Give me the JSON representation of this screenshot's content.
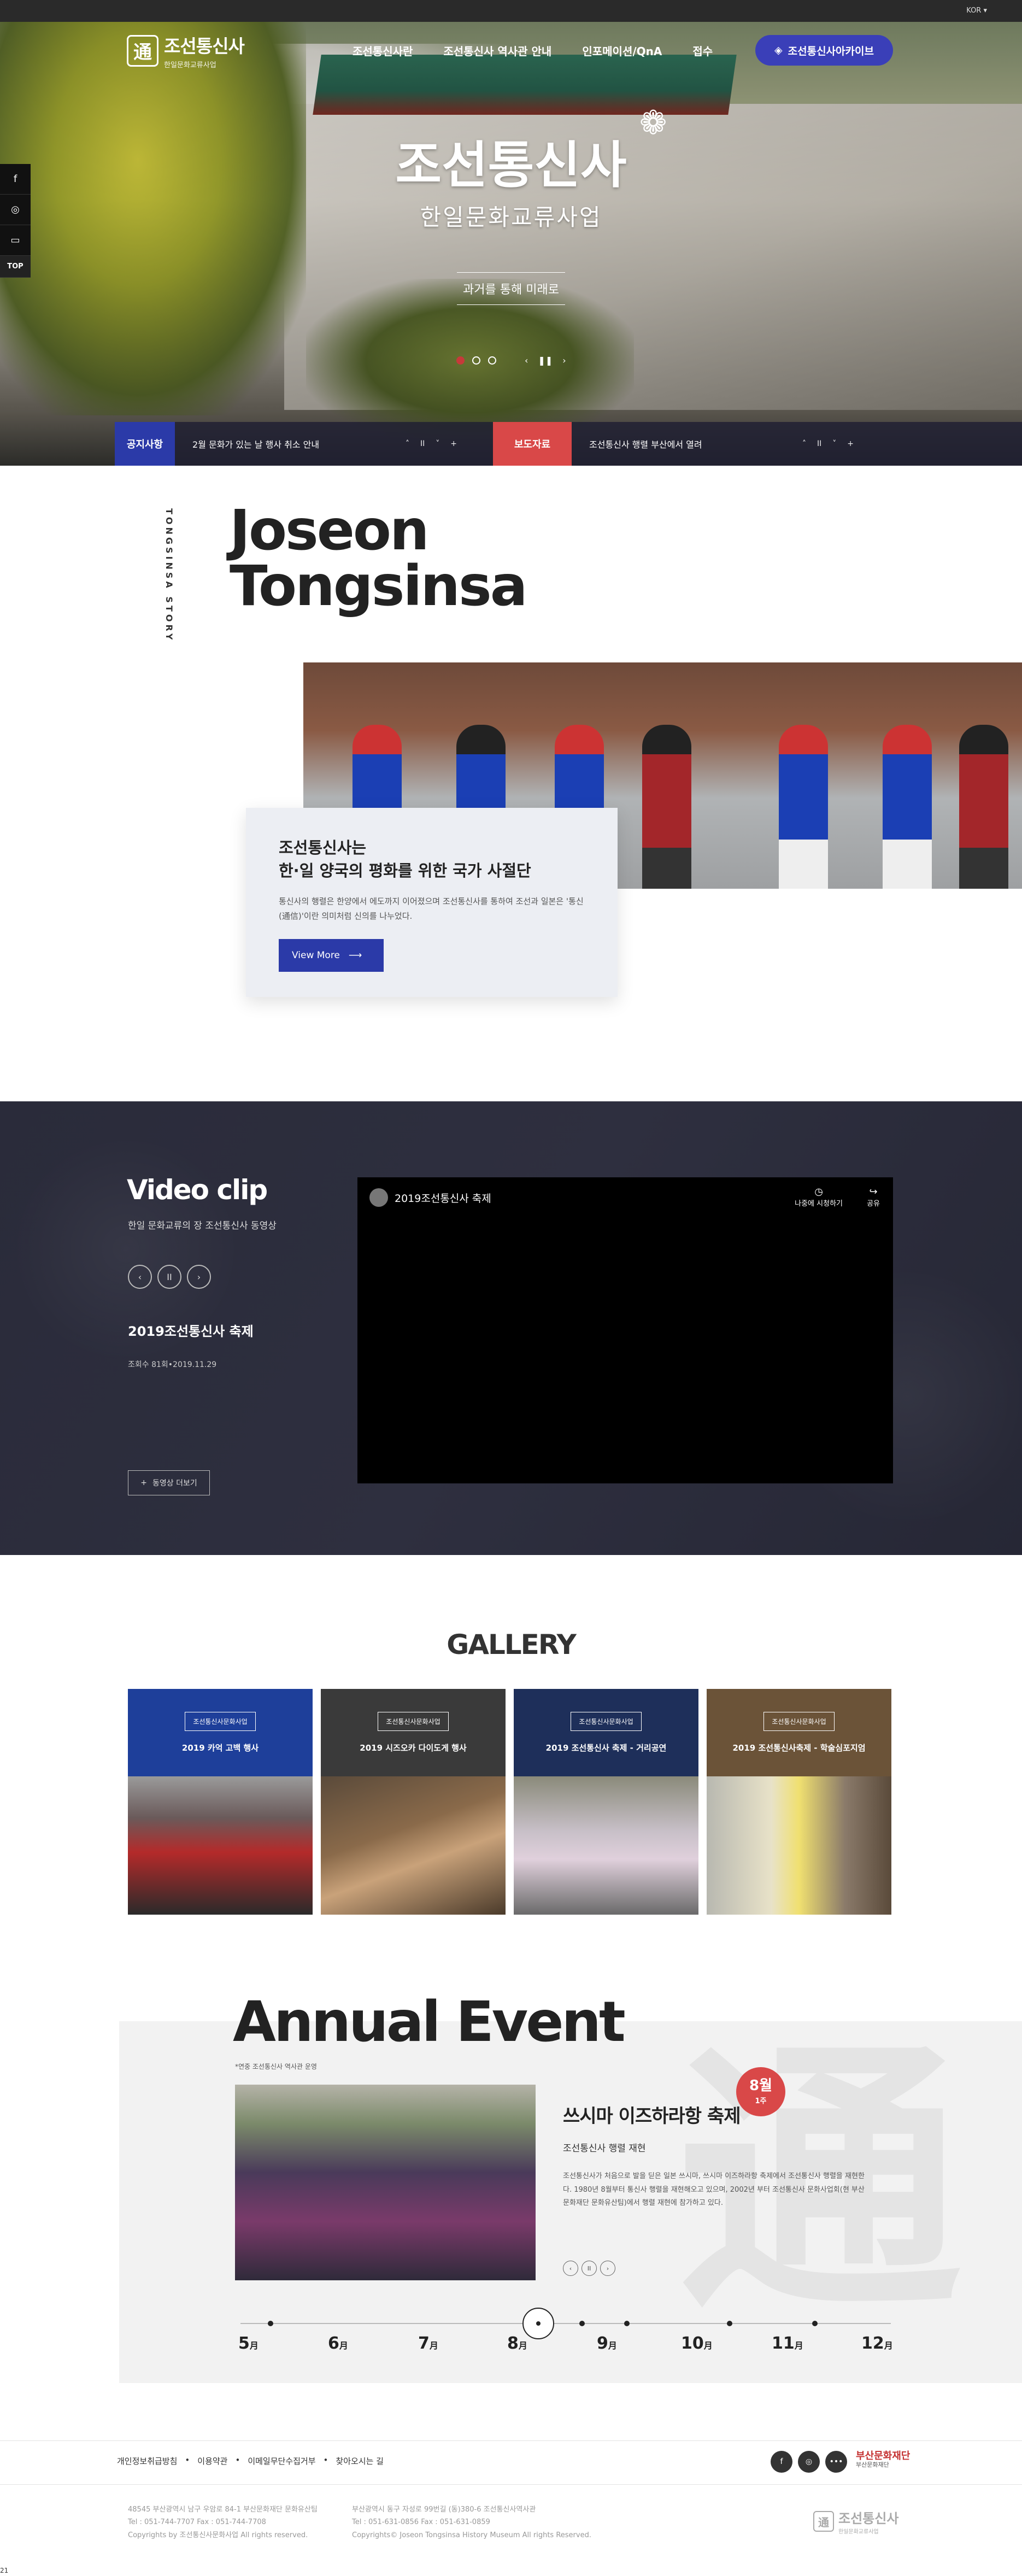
{
  "topbar": {
    "lang": "KOR ▾"
  },
  "header": {
    "logo_mark": "通",
    "logo_title": "조선통신사",
    "logo_sub": "한일문화교류사업",
    "nav": [
      "조선통신사란",
      "조선통신사 역사관 안내",
      "인포메이션/QnA",
      "접수"
    ],
    "archive_btn": "조선통신사아카이브"
  },
  "hero": {
    "title": "조선통신사",
    "subtitle": "한일문화교류사업",
    "tag": "과거를 통해 미래로",
    "controls": [
      "‹",
      "❚❚",
      "›"
    ]
  },
  "social": {
    "items": [
      "f",
      "◎",
      "▭"
    ],
    "top": "TOP"
  },
  "notice": {
    "notice_label": "공지사항",
    "notice_text": "2월 문화가 있는 날 행사 취소 안내",
    "press_label": "보도자료",
    "press_text": "조선통신사 행렬 부산에서 열려",
    "controls": [
      "˄",
      "II",
      "˅",
      "+"
    ]
  },
  "story": {
    "side_label": "TONGSINSA STORY",
    "title_1": "Joseon",
    "title_2": "Tongsinsa",
    "card_title_1": "조선통신사는",
    "card_title_2": "한·일 양국의 평화를 위한 국가 사절단",
    "card_desc": "통신사의 행렬은 한양에서 에도까지 이어졌으며 조선통신사를 통하여 조선과 일본은 '통신(通信)'이란 의미처럼 신의를 나누었다.",
    "view_more": "View More",
    "arrow": "⟶"
  },
  "video": {
    "title": "Video clip",
    "subtitle": "한일 문화교류의 장 조선통신사 동영상",
    "controls": [
      "‹",
      "II",
      "›"
    ],
    "clip_name": "2019조선통신사 축제",
    "clip_meta": "조회수 81회•2019.11.29",
    "more_btn": "동영상 더보기",
    "more_icon": "+",
    "player_title": "2019조선통신사 축제",
    "player_watch": "나중에 시청하기",
    "player_share": "공유"
  },
  "gallery": {
    "title": "GALLERY",
    "items": [
      {
        "badge": "조선통신사문화사업",
        "name": "2019 카억 고백 행사",
        "color": "#1e3f9a"
      },
      {
        "badge": "조선통신사문화사업",
        "name": "2019 시즈오카 다이도게 행사",
        "color": "#3a3a3a"
      },
      {
        "badge": "조선통신사문화사업",
        "name": "2019 조선통신사 축제 - 거리공연",
        "color": "#1e2f5a"
      },
      {
        "badge": "조선통신사문화사업",
        "name": "2019 조선통신사축제 - 학술심포지엄",
        "color": "#6b5338"
      }
    ]
  },
  "annual": {
    "title": "Annual Event",
    "watermark": "通",
    "note": "*연중 조선통신사 역사관 운영",
    "badge_month": "8월",
    "badge_week": "1주",
    "event_name": "쓰시마 이즈하라항 축제",
    "event_sub": "조선통신사 행렬 재현",
    "event_desc": "조선통신사가 처음으로 발을 딛은 일본 쓰시마, 쓰시마 이즈하라항 축제에서 조선통신사 행렬을 재현한다. 1980년 8월부터 통신사 행렬을 재현해오고 있으며, 2002년 부터 조선통신사 문화사업회(현 부산문화재단 문화유산팀)에서 행렬 재현에 참가하고 있다.",
    "controls": [
      "‹",
      "II",
      "›"
    ],
    "months": [
      {
        "n": "5",
        "u": "月"
      },
      {
        "n": "6",
        "u": "月"
      },
      {
        "n": "7",
        "u": "月"
      },
      {
        "n": "8",
        "u": "月"
      },
      {
        "n": "9",
        "u": "月"
      },
      {
        "n": "10",
        "u": "月"
      },
      {
        "n": "11",
        "u": "月"
      },
      {
        "n": "12",
        "u": "月"
      }
    ]
  },
  "footer": {
    "links": [
      "개인정보취급방침",
      "이용약관",
      "이메일무단수집거부",
      "찾아오시는 길"
    ],
    "sns": [
      "f",
      "◎",
      "•••"
    ],
    "partner": "부산문화재단",
    "partner_sub": "부산문화재단",
    "addr1_l1": "48545 부산광역시 남구 우암로 84-1 부산문화재단 문화유산팀",
    "addr1_l2": "Tel : 051-744-7707 Fax : 051-744-7708",
    "addr1_l3": "Copyrights by 조선통신사문화사업 All rights reserved.",
    "addr2_l1": "부산광역시 동구 자성로 99번길 (동)380-6 조선통신사역사관",
    "addr2_l2": "Tel : 051-631-0856 Fax : 051-631-0859",
    "addr2_l3": "Copyrights© Joseon Tongsinsa History Museum All rights Reserved.",
    "logo_mark": "通",
    "logo_title": "조선통신사",
    "logo_sub": "한일문화교류사업"
  },
  "page_no": "21"
}
